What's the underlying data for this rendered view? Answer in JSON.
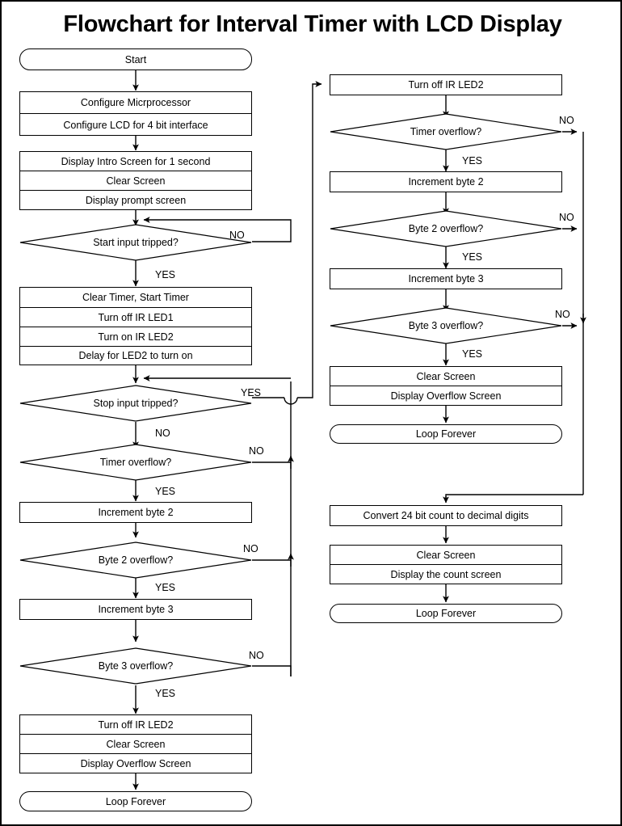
{
  "title": "Flowchart for Interval Timer with LCD Display",
  "chart_data": {
    "type": "diagram",
    "diagram_kind": "flowchart",
    "title": "Flowchart for Interval Timer with LCD Display",
    "columns": 2,
    "node_count": 26
  },
  "left_column": {
    "start": {
      "label": "Start",
      "shape": "terminator"
    },
    "config_block": {
      "shape": "process-group",
      "rows": [
        "Configure Micrprocessor",
        "Configure LCD for 4 bit interface"
      ]
    },
    "intro_block": {
      "shape": "process-group",
      "rows": [
        "Display Intro Screen for 1 second",
        "Clear Screen",
        "Display prompt screen"
      ]
    },
    "start_input_decision": {
      "label": "Start input tripped?",
      "shape": "decision",
      "yes": "YES",
      "no": "NO"
    },
    "timer_block": {
      "shape": "process-group",
      "rows": [
        "Clear Timer, Start Timer",
        "Turn off IR LED1",
        "Turn on IR LED2",
        "Delay for LED2 to turn on"
      ]
    },
    "stop_input_decision": {
      "label": "Stop input tripped?",
      "shape": "decision",
      "yes": "YES",
      "no": "NO"
    },
    "timer_overflow_decision": {
      "label": "Timer overflow?",
      "shape": "decision",
      "yes": "YES",
      "no": "NO"
    },
    "increment_byte2": {
      "label": "Increment byte 2",
      "shape": "process"
    },
    "byte2_overflow_decision": {
      "label": "Byte 2 overflow?",
      "shape": "decision",
      "yes": "YES",
      "no": "NO"
    },
    "increment_byte3": {
      "label": "Increment byte 3",
      "shape": "process"
    },
    "byte3_overflow_decision": {
      "label": "Byte 3 overflow?",
      "shape": "decision",
      "yes": "YES",
      "no": "NO"
    },
    "overflow_block": {
      "shape": "process-group",
      "rows": [
        "Turn off IR LED2",
        "Clear Screen",
        "Display Overflow Screen"
      ]
    },
    "loop_forever": {
      "label": "Loop Forever",
      "shape": "terminator"
    }
  },
  "right_column": {
    "turn_off_led2": {
      "label": "Turn off IR LED2",
      "shape": "process"
    },
    "timer_overflow_decision": {
      "label": "Timer overflow?",
      "shape": "decision",
      "yes": "YES",
      "no": "NO"
    },
    "increment_byte2": {
      "label": "Increment byte 2",
      "shape": "process"
    },
    "byte2_overflow_decision": {
      "label": "Byte 2 overflow?",
      "shape": "decision",
      "yes": "YES",
      "no": "NO"
    },
    "increment_byte3": {
      "label": "Increment byte 3",
      "shape": "process"
    },
    "byte3_overflow_decision": {
      "label": "Byte 3 overflow?",
      "shape": "decision",
      "yes": "YES",
      "no": "NO"
    },
    "overflow_block": {
      "shape": "process-group",
      "rows": [
        "Clear Screen",
        "Display Overflow Screen"
      ]
    },
    "loop_forever_overflow": {
      "label": "Loop Forever",
      "shape": "terminator"
    },
    "convert_count": {
      "label": "Convert 24 bit count to decimal digits",
      "shape": "process"
    },
    "display_block": {
      "shape": "process-group",
      "rows": [
        "Clear Screen",
        "Display  the count screen"
      ]
    },
    "loop_forever_count": {
      "label": "Loop Forever",
      "shape": "terminator"
    }
  },
  "colors": {
    "stroke": "#000000",
    "fill": "#ffffff",
    "text": "#000000",
    "border": "#000000"
  }
}
